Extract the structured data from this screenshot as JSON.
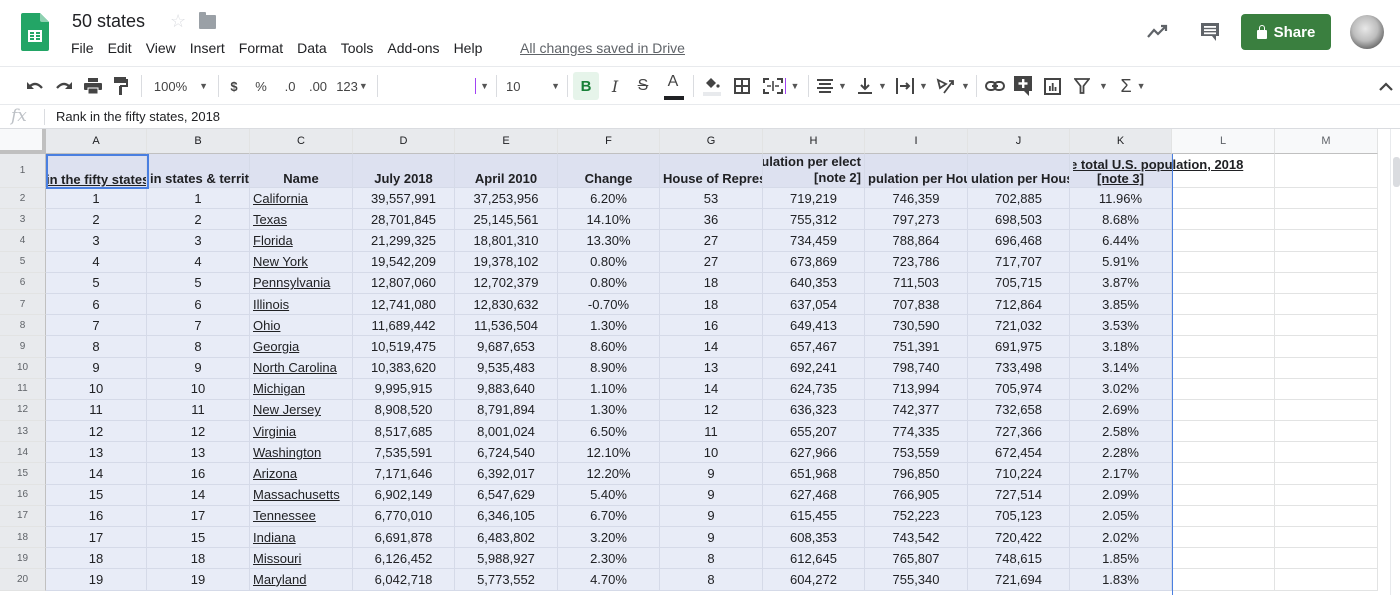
{
  "app": {
    "title": "50 states",
    "menu": [
      "File",
      "Edit",
      "View",
      "Insert",
      "Format",
      "Data",
      "Tools",
      "Add-ons",
      "Help"
    ],
    "saved_status": "All changes saved in Drive",
    "share_label": "Share",
    "colors": {
      "share": "#3a7f3f",
      "selection": "#4a7fe0",
      "bold_active": "#188038"
    }
  },
  "toolbar": {
    "zoom": "100%",
    "currency": "$",
    "percent": "%",
    "decrease_decimals": ".0",
    "increase_decimals": ".00",
    "more_formats": "123",
    "font_family": "",
    "font_size": "10",
    "bold": "B",
    "italic": "I",
    "strike": "S",
    "text_color": "A"
  },
  "formula_bar": {
    "fx": "fx",
    "content": "Rank in the fifty states, 2018"
  },
  "grid": {
    "columns": [
      "A",
      "B",
      "C",
      "D",
      "E",
      "F",
      "G",
      "H",
      "I",
      "J",
      "K",
      "L",
      "M"
    ],
    "row_numbers": [
      "1",
      "2",
      "3",
      "4",
      "5",
      "6",
      "7",
      "8",
      "9",
      "10",
      "11",
      "12",
      "13",
      "14",
      "15",
      "16",
      "17",
      "18",
      "19",
      "20"
    ],
    "header": {
      "A": "in the fifty states",
      "B": "in states & territ",
      "C": "Name",
      "D": "July 2018",
      "E": "April 2010",
      "F": "Change",
      "G": "House of Repres",
      "H_top": "ulation per elect",
      "H_bottom": "[note 2]",
      "I": "pulation per Hou",
      "J": "ulation per Hous",
      "K_top": "e total U.S. population, 2018",
      "K_bottom": "[note 3]"
    },
    "rows": [
      [
        "1",
        "1",
        "California",
        "39,557,991",
        "37,253,956",
        "6.20%",
        "53",
        "719,219",
        "746,359",
        "702,885",
        "11.96%"
      ],
      [
        "2",
        "2",
        "Texas",
        "28,701,845",
        "25,145,561",
        "14.10%",
        "36",
        "755,312",
        "797,273",
        "698,503",
        "8.68%"
      ],
      [
        "3",
        "3",
        "Florida",
        "21,299,325",
        "18,801,310",
        "13.30%",
        "27",
        "734,459",
        "788,864",
        "696,468",
        "6.44%"
      ],
      [
        "4",
        "4",
        "New York",
        "19,542,209",
        "19,378,102",
        "0.80%",
        "27",
        "673,869",
        "723,786",
        "717,707",
        "5.91%"
      ],
      [
        "5",
        "5",
        "Pennsylvania",
        "12,807,060",
        "12,702,379",
        "0.80%",
        "18",
        "640,353",
        "711,503",
        "705,715",
        "3.87%"
      ],
      [
        "6",
        "6",
        "Illinois",
        "12,741,080",
        "12,830,632",
        "-0.70%",
        "18",
        "637,054",
        "707,838",
        "712,864",
        "3.85%"
      ],
      [
        "7",
        "7",
        "Ohio",
        "11,689,442",
        "11,536,504",
        "1.30%",
        "16",
        "649,413",
        "730,590",
        "721,032",
        "3.53%"
      ],
      [
        "8",
        "8",
        "Georgia",
        "10,519,475",
        "9,687,653",
        "8.60%",
        "14",
        "657,467",
        "751,391",
        "691,975",
        "3.18%"
      ],
      [
        "9",
        "9",
        "North Carolina",
        "10,383,620",
        "9,535,483",
        "8.90%",
        "13",
        "692,241",
        "798,740",
        "733,498",
        "3.14%"
      ],
      [
        "10",
        "10",
        "Michigan",
        "9,995,915",
        "9,883,640",
        "1.10%",
        "14",
        "624,735",
        "713,994",
        "705,974",
        "3.02%"
      ],
      [
        "11",
        "11",
        "New Jersey",
        "8,908,520",
        "8,791,894",
        "1.30%",
        "12",
        "636,323",
        "742,377",
        "732,658",
        "2.69%"
      ],
      [
        "12",
        "12",
        "Virginia",
        "8,517,685",
        "8,001,024",
        "6.50%",
        "11",
        "655,207",
        "774,335",
        "727,366",
        "2.58%"
      ],
      [
        "13",
        "13",
        "Washington",
        "7,535,591",
        "6,724,540",
        "12.10%",
        "10",
        "627,966",
        "753,559",
        "672,454",
        "2.28%"
      ],
      [
        "14",
        "16",
        "Arizona",
        "7,171,646",
        "6,392,017",
        "12.20%",
        "9",
        "651,968",
        "796,850",
        "710,224",
        "2.17%"
      ],
      [
        "15",
        "14",
        "Massachusetts",
        "6,902,149",
        "6,547,629",
        "5.40%",
        "9",
        "627,468",
        "766,905",
        "727,514",
        "2.09%"
      ],
      [
        "16",
        "17",
        "Tennessee",
        "6,770,010",
        "6,346,105",
        "6.70%",
        "9",
        "615,455",
        "752,223",
        "705,123",
        "2.05%"
      ],
      [
        "17",
        "15",
        "Indiana",
        "6,691,878",
        "6,483,802",
        "3.20%",
        "9",
        "608,353",
        "743,542",
        "720,422",
        "2.02%"
      ],
      [
        "18",
        "18",
        "Missouri",
        "6,126,452",
        "5,988,927",
        "2.30%",
        "8",
        "612,645",
        "765,807",
        "748,615",
        "1.85%"
      ],
      [
        "19",
        "19",
        "Maryland",
        "6,042,718",
        "5,773,552",
        "4.70%",
        "8",
        "604,272",
        "755,340",
        "721,694",
        "1.83%"
      ]
    ]
  }
}
